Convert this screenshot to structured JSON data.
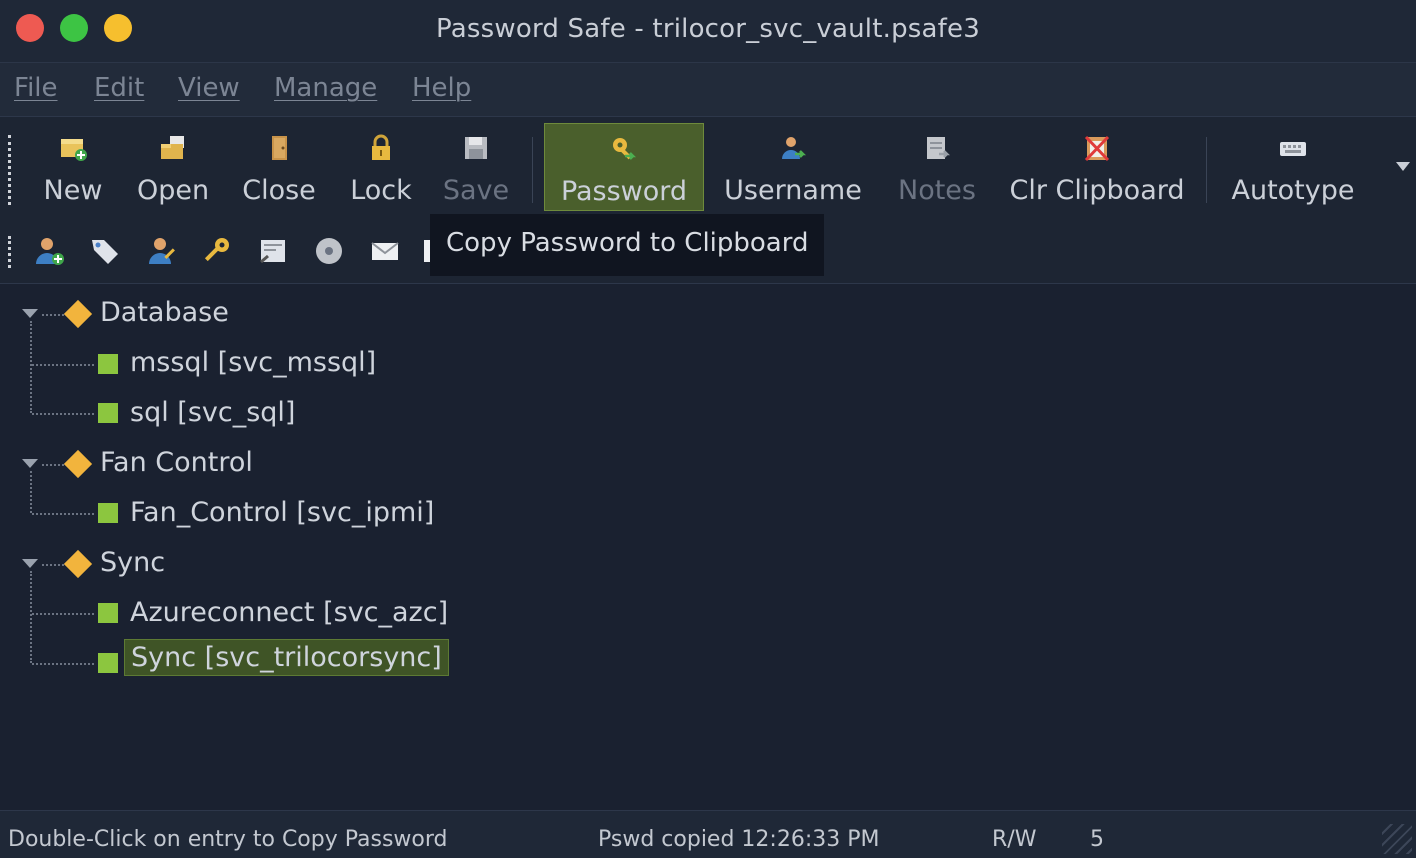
{
  "window": {
    "title": "Password Safe - trilocor_svc_vault.psafe3"
  },
  "menu": [
    {
      "label": "File"
    },
    {
      "label": "Edit"
    },
    {
      "label": "View"
    },
    {
      "label": "Manage"
    },
    {
      "label": "Help"
    }
  ],
  "toolbar": {
    "buttons": [
      {
        "label": "New",
        "icon": "new-database-icon",
        "enabled": true
      },
      {
        "label": "Open",
        "icon": "open-folder-icon",
        "enabled": true
      },
      {
        "label": "Close",
        "icon": "close-door-icon",
        "enabled": true
      },
      {
        "label": "Lock",
        "icon": "padlock-icon",
        "enabled": true
      },
      {
        "label": "Save",
        "icon": "floppy-disk-icon",
        "enabled": false
      },
      {
        "label": "Password",
        "icon": "key-copy-icon",
        "enabled": true,
        "active": true
      },
      {
        "label": "Username",
        "icon": "user-copy-icon",
        "enabled": true
      },
      {
        "label": "Notes",
        "icon": "notes-copy-icon",
        "enabled": false
      },
      {
        "label": "Clr Clipboard",
        "icon": "clear-clipboard-icon",
        "enabled": true
      },
      {
        "label": "Autotype",
        "icon": "keyboard-icon",
        "enabled": true
      }
    ]
  },
  "toolbar2": {
    "icons": [
      "add-entry-icon",
      "tag-icon",
      "edit-entry-icon",
      "key-icon",
      "view-entry-icon",
      "disc-icon",
      "email-icon",
      "document-icon"
    ]
  },
  "tooltip": {
    "text": "Copy Password to Clipboard"
  },
  "tree": {
    "groups": [
      {
        "label": "Database",
        "entries": [
          "mssql [svc_mssql]",
          "sql [svc_sql]"
        ]
      },
      {
        "label": "Fan Control",
        "entries": [
          "Fan_Control [svc_ipmi]"
        ]
      },
      {
        "label": "Sync",
        "entries": [
          "Azureconnect [svc_azc]",
          "Sync [svc_trilocorsync]"
        ]
      }
    ],
    "selected": "Sync [svc_trilocorsync]"
  },
  "status": {
    "hint": "Double-Click on entry to Copy Password",
    "message": "Pswd copied 12:26:33 PM",
    "mode": "R/W",
    "count": "5"
  },
  "colors": {
    "selection": "#3f5426",
    "group_icon": "#f2b43d",
    "entry_icon": "#8cc63f"
  }
}
